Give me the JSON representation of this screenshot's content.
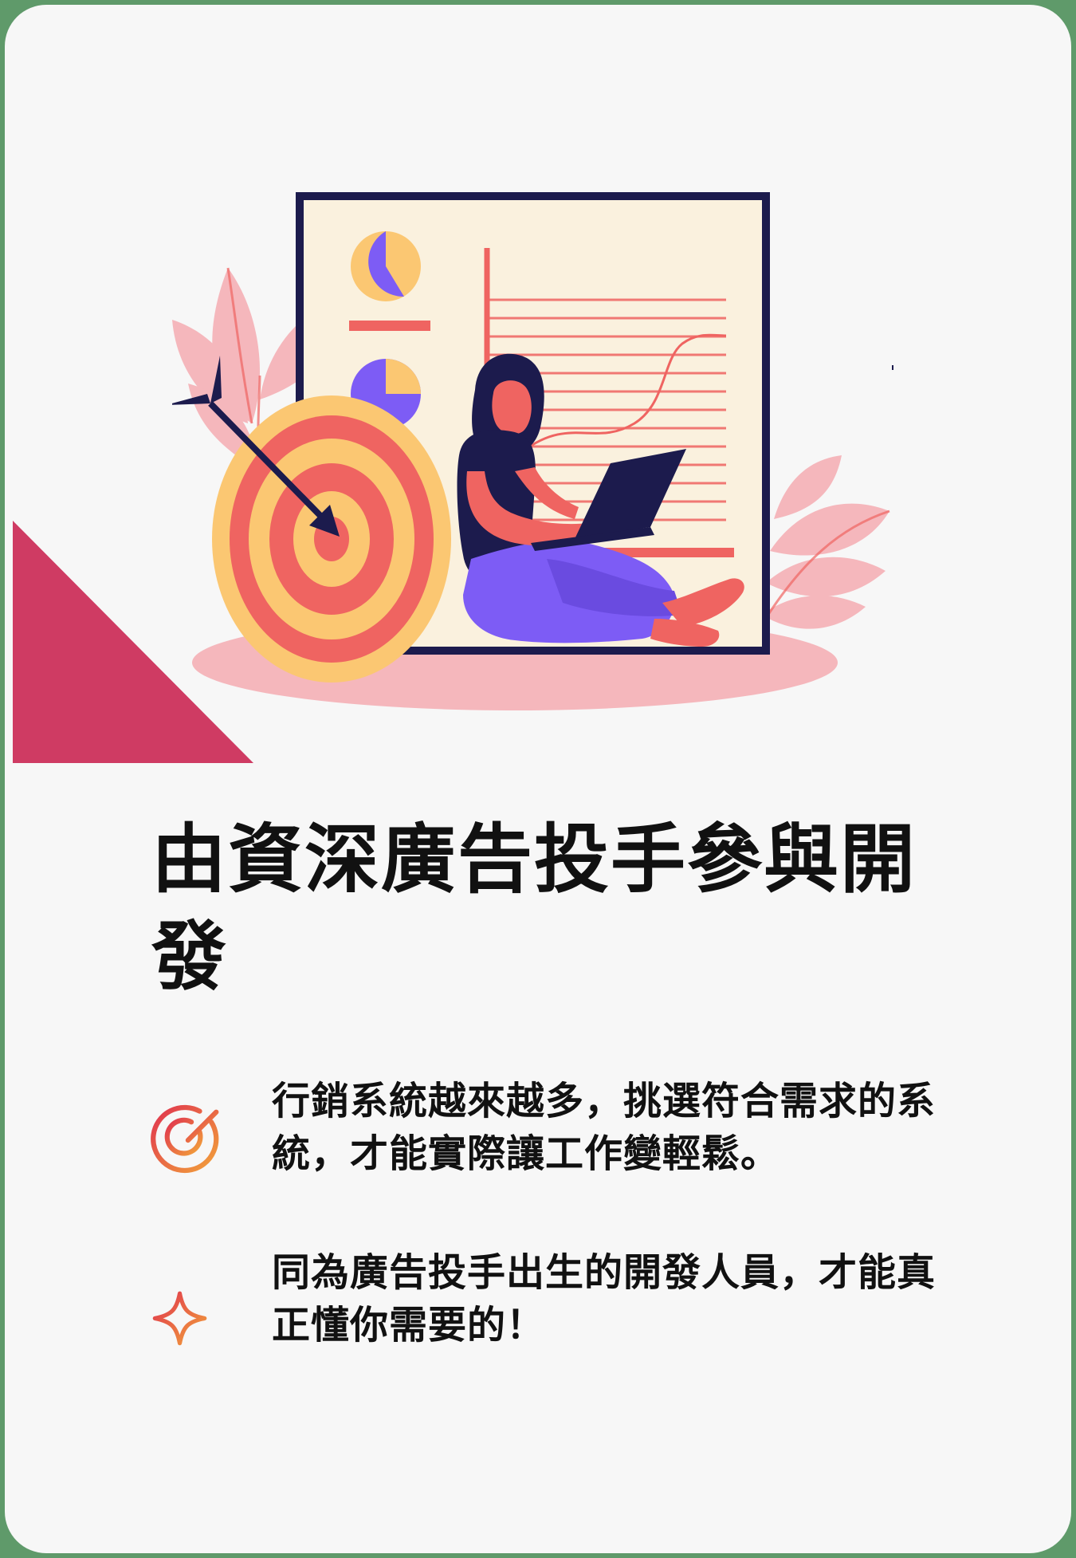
{
  "headline": "由資深廣告投手參與開發",
  "features": [
    {
      "icon": "target-icon",
      "text": "行銷系統越來越多，挑選符合需求的系統，才能實際讓工作變輕鬆。"
    },
    {
      "icon": "sparkle-icon",
      "text": "同為廣告投手出生的開發人員，才能真正懂你需要的！"
    }
  ],
  "colors": {
    "background_frame": "#5f9a6a",
    "card": "#f7f7f7",
    "accent_triangle": "#cf3b63",
    "text": "#111111",
    "illustration_navy": "#1c1b4d",
    "illustration_coral": "#ef6461",
    "illustration_yellow": "#fbc772",
    "illustration_purple": "#7d5cf5",
    "illustration_pink": "#f5b7bc",
    "board_paper": "#faf1de"
  }
}
